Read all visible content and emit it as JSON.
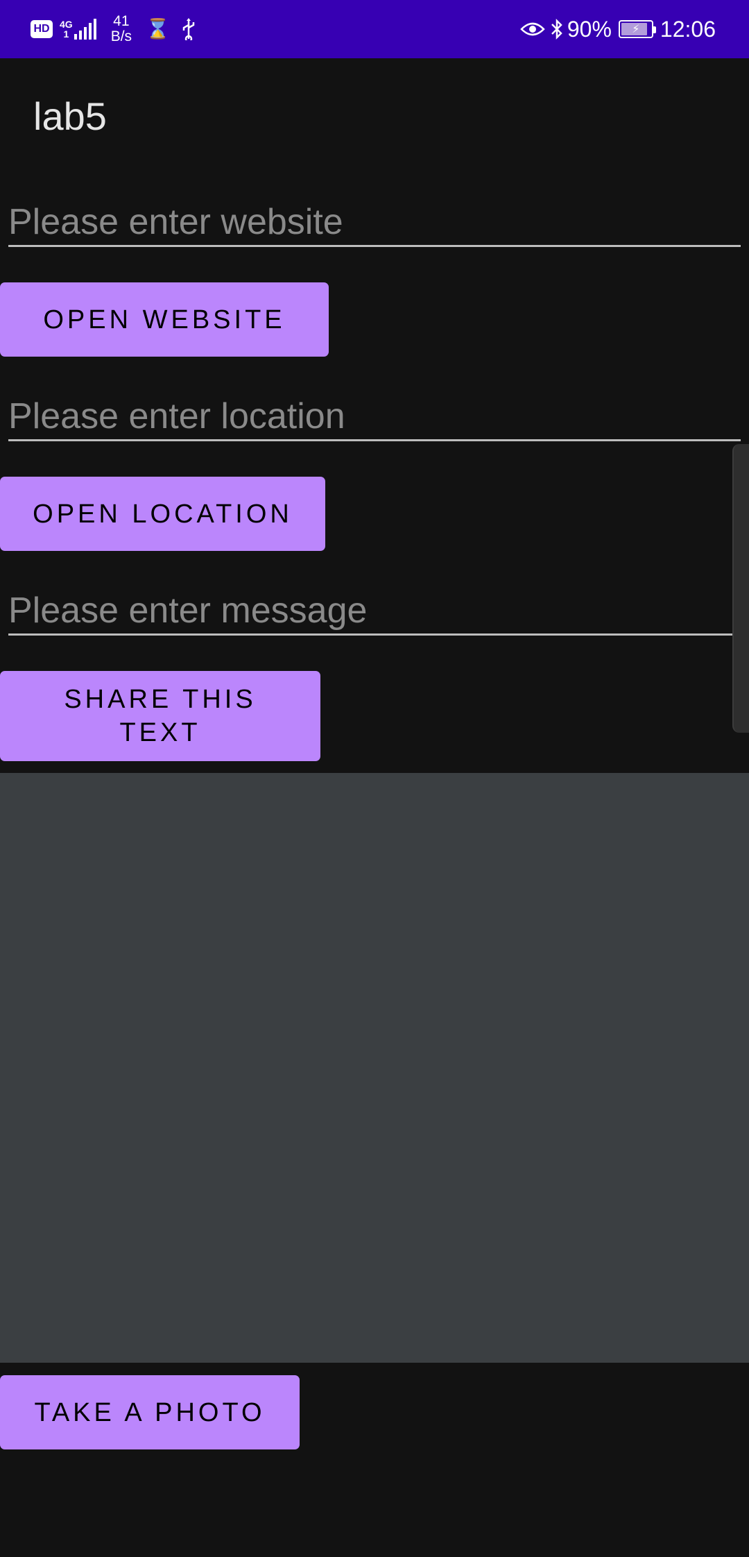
{
  "status_bar": {
    "hd": "HD",
    "network_type": "4G",
    "network_sub": "1",
    "speed_value": "41",
    "speed_unit": "B/s",
    "battery": "90%",
    "battery_level": 0.9,
    "time": "12:06",
    "icons": [
      "hd-icon",
      "signal-icon",
      "hourglass-icon",
      "usb-icon",
      "eye-icon",
      "bluetooth-icon",
      "battery-charging-icon"
    ]
  },
  "app": {
    "title": "lab5"
  },
  "website": {
    "placeholder": "Please enter website",
    "value": "",
    "button_label": "OPEN WEBSITE"
  },
  "location": {
    "placeholder": "Please enter location",
    "value": "",
    "button_label": "OPEN LOCATION"
  },
  "message": {
    "placeholder": "Please enter message",
    "value": "",
    "button_label_line1": "SHARE THIS",
    "button_label_line2": "TEXT"
  },
  "photo": {
    "button_label": "TAKE A PHOTO"
  },
  "colors": {
    "status_bar": "#3700B3",
    "background": "#121212",
    "button": "#BB86FC",
    "image_area": "#3B3F42"
  }
}
